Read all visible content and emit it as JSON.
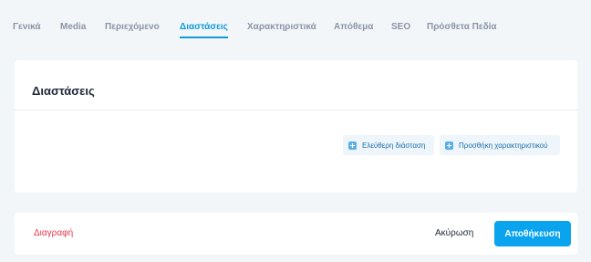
{
  "tabs": [
    {
      "label": "Γενικά"
    },
    {
      "label": "Media"
    },
    {
      "label": "Περιεχόμενο"
    },
    {
      "label": "Διαστάσεις",
      "active": true
    },
    {
      "label": "Χαρακτηριστικά"
    },
    {
      "label": "Απόθεμα"
    },
    {
      "label": "SEO"
    },
    {
      "label": "Πρόσθετα Πεδία"
    }
  ],
  "card": {
    "title": "Διαστάσεις",
    "actions": {
      "free_dimension": "Ελεύθερη διάσταση",
      "add_attribute": "Προσθήκη χαρακτηριστικού"
    }
  },
  "footer": {
    "delete_label": "Διαγραφή",
    "cancel_label": "Ακύρωση",
    "save_label": "Αποθήκευση"
  },
  "colors": {
    "accent": "#0f9bd8",
    "danger": "#e0384b",
    "primary_button": "#0aa3ee",
    "background": "#f3f6f9"
  },
  "icons": {
    "pill_icon": "plus-icon"
  }
}
